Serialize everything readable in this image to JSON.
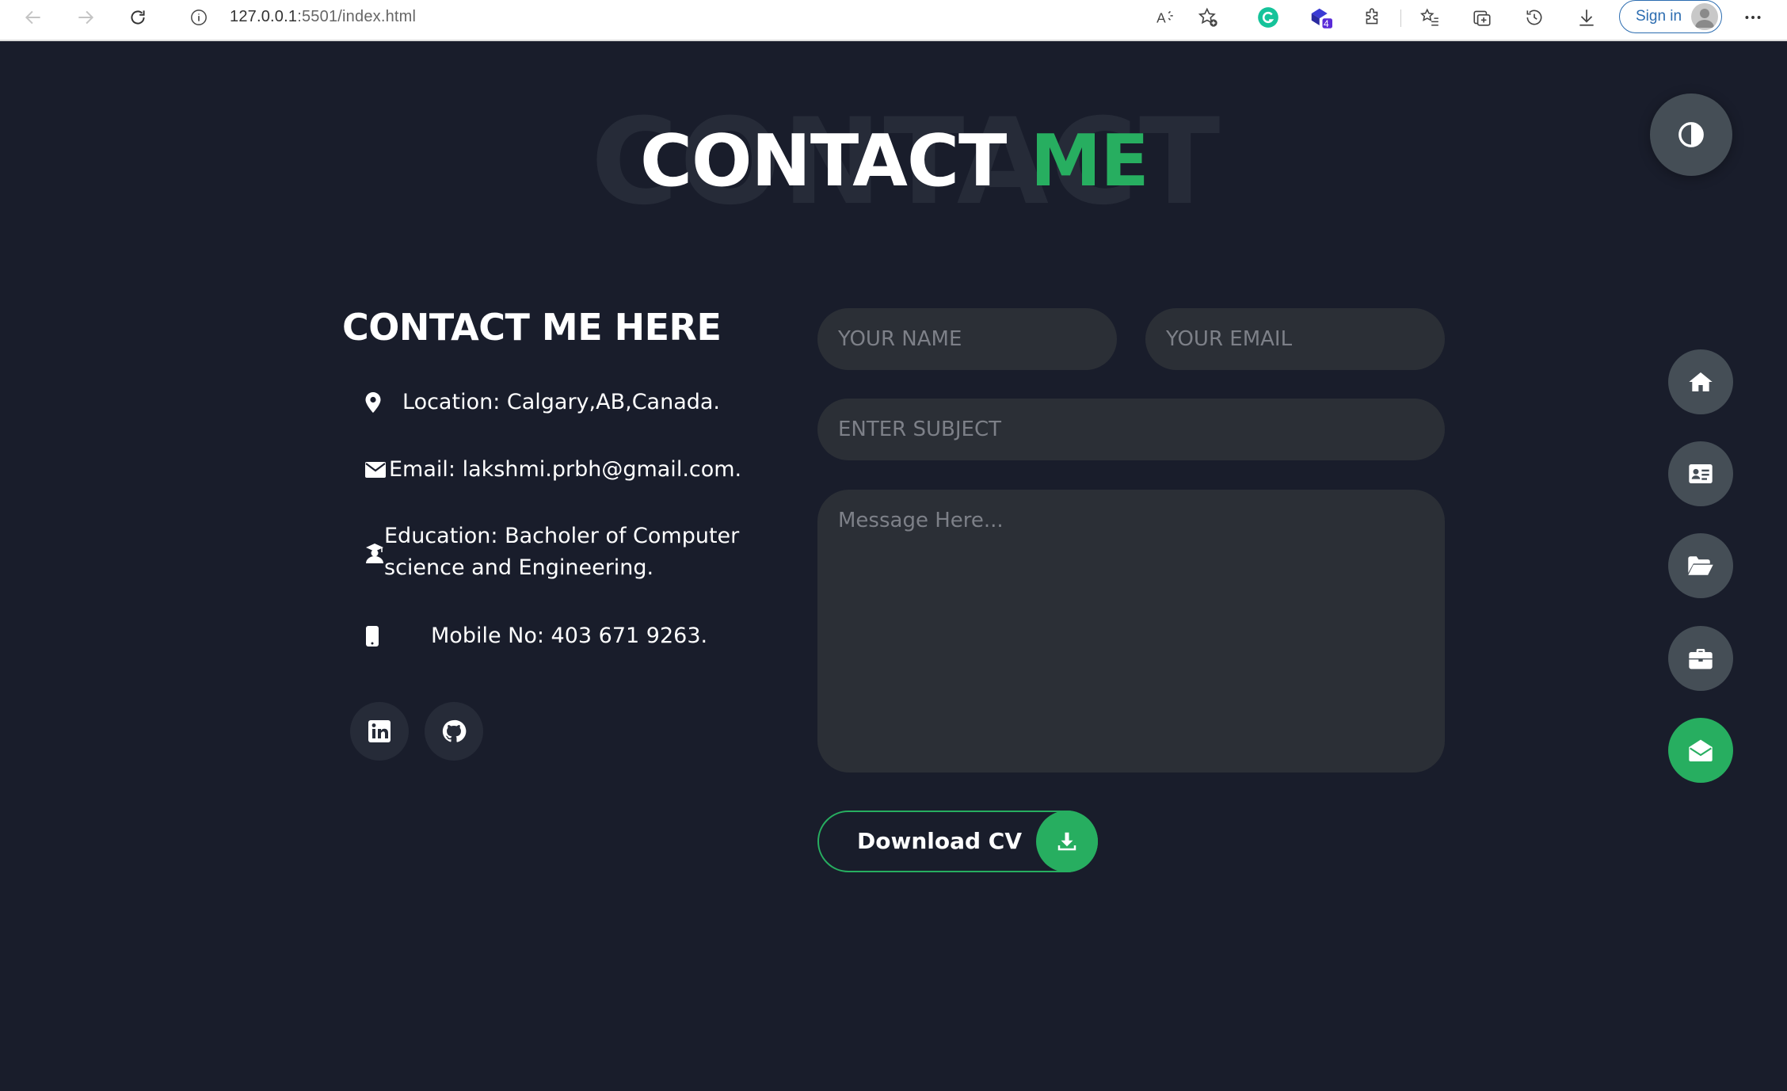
{
  "browser": {
    "url_host": "127.0.0.1",
    "url_rest": ":5501/index.html",
    "extension_badge": "4",
    "sign_in_label": "Sign in"
  },
  "title": {
    "background_text": "CONTACT",
    "main": "CONTACT",
    "accent": "ME"
  },
  "info": {
    "heading": "CONTACT ME HERE",
    "location": "Location: Calgary,AB,Canada.",
    "email": "Email: lakshmi.prbh@gmail.com.",
    "education_line1": "Education: Bacholer of Computer",
    "education_line2": "science and Engineering.",
    "mobile": "Mobile No: 403 671 9263."
  },
  "social": [
    {
      "icon": "linkedin-icon"
    },
    {
      "icon": "github-icon"
    }
  ],
  "form": {
    "name_placeholder": "YOUR NAME",
    "email_placeholder": "YOUR EMAIL",
    "subject_placeholder": "ENTER SUBJECT",
    "message_placeholder": "Message Here..."
  },
  "download_button": {
    "label": "Download CV",
    "icon": "download-icon"
  },
  "side_nav": [
    {
      "icon": "home-icon",
      "active": false
    },
    {
      "icon": "id-card-icon",
      "active": false
    },
    {
      "icon": "folder-open-icon",
      "active": false
    },
    {
      "icon": "briefcase-icon",
      "active": false
    },
    {
      "icon": "envelope-open-icon",
      "active": true
    }
  ],
  "colors": {
    "background": "#191d2b",
    "accent": "#27ae60",
    "field": "#2b2f36",
    "button_grey": "#454e56"
  }
}
